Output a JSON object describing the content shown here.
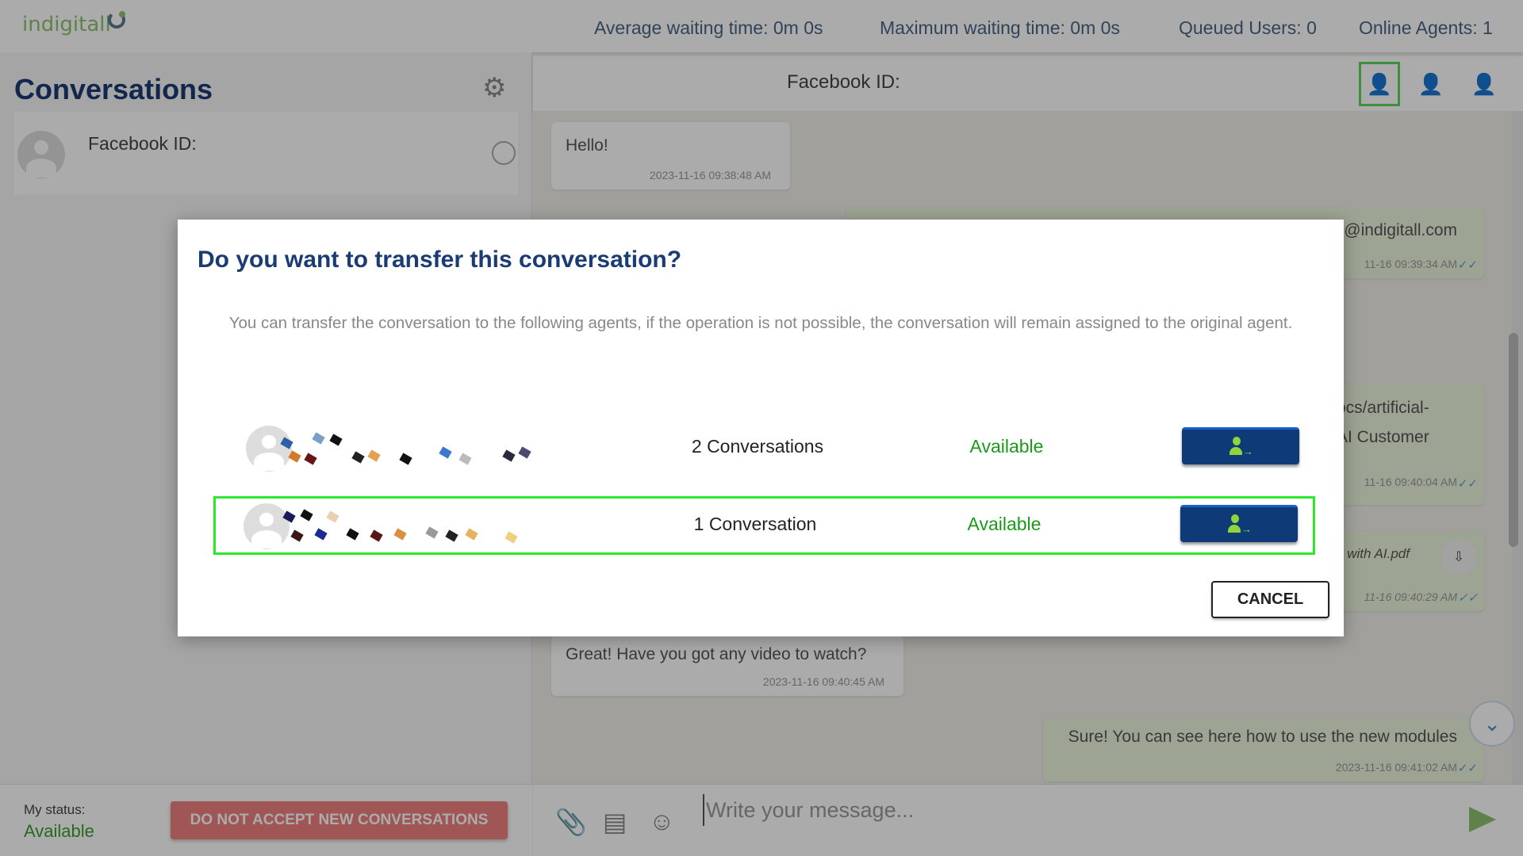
{
  "topbar": {
    "logo": "indigitall",
    "stats": [
      "Average waiting time: 0m 0s",
      "Maximum waiting time: 0m 0s",
      "Queued Users: 0",
      "Online Agents: 1"
    ]
  },
  "sidebar": {
    "title": "Conversations",
    "item": {
      "label": "Facebook ID:"
    }
  },
  "chat": {
    "header": "Facebook ID:",
    "messages": [
      {
        "text": "Hello!",
        "time": "2023-11-16 09:38:48 AM",
        "dir": "in"
      },
      {
        "text": "@indigitall.com",
        "time": "11-16 09:39:34 AM",
        "dir": "out"
      },
      {
        "text": "ocs/artificial-\nAI Customer",
        "time": "11-16 09:40:04 AM",
        "dir": "out"
      },
      {
        "text": "y with AI.pdf",
        "time": "11-16 09:40:29 AM",
        "dir": "out"
      },
      {
        "text": "Great! Have you got any video to watch?",
        "time": "2023-11-16 09:40:45 AM",
        "dir": "in"
      },
      {
        "text": "Sure! You can see here how to use the new modules",
        "time": "2023-11-16 09:41:02 AM",
        "dir": "out"
      }
    ]
  },
  "footer": {
    "status_label": "My status:",
    "status_value": "Available",
    "dna_button": "DO NOT ACCEPT NEW CONVERSATIONS",
    "input_placeholder": "Write your message..."
  },
  "modal": {
    "title": "Do you want to transfer this conversation?",
    "description": "You can transfer the conversation to the following agents, if the operation is not possible, the conversation will remain assigned to the original agent.",
    "agents": [
      {
        "conversations": "2 Conversations",
        "status": "Available"
      },
      {
        "conversations": "1 Conversation",
        "status": "Available"
      }
    ],
    "cancel": "CANCEL"
  },
  "colors": {
    "brand": "#8dc26f",
    "title": "#1a3b73",
    "button": "#0f3a78",
    "available": "#1a9a1a",
    "highlight": "#2ee82e"
  }
}
